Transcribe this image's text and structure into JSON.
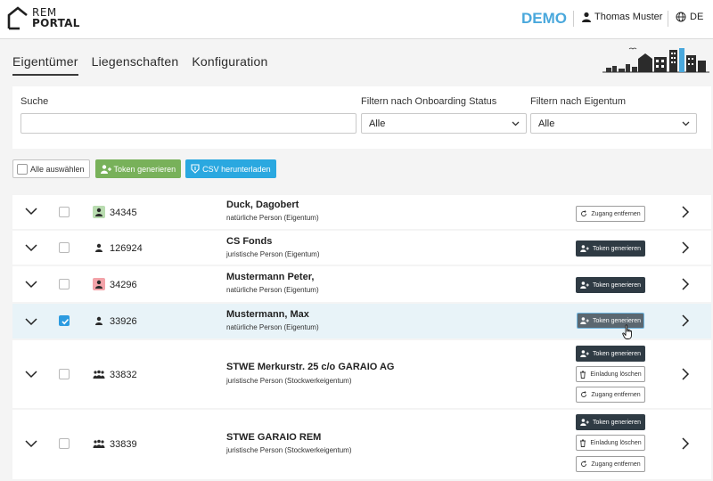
{
  "header": {
    "logo_line1": "REM",
    "logo_line2": "PORTAL",
    "environment": "DEMO",
    "user_name": "Thomas Muster",
    "language": "DE"
  },
  "tabs": [
    {
      "label": "Eigentümer",
      "active": true
    },
    {
      "label": "Liegenschaften",
      "active": false
    },
    {
      "label": "Konfiguration",
      "active": false
    }
  ],
  "filters": {
    "search_label": "Suche",
    "search_value": "",
    "onboarding_label": "Filtern nach Onboarding Status",
    "onboarding_value": "Alle",
    "property_label": "Filtern nach Eigentum",
    "property_value": "Alle"
  },
  "actions": {
    "select_all": "Alle auswählen",
    "generate_tokens": "Token generieren",
    "download_csv": "CSV herunterladen"
  },
  "owners": [
    {
      "id": "34345",
      "name": "Duck, Dagobert",
      "type": "natürliche Person (Eigentum)",
      "icon": "person-icon",
      "icon_bg": "#b9dcb0",
      "checked": false,
      "buttons": [
        "Zugang entfernen"
      ]
    },
    {
      "id": "126924",
      "name": "CS Fonds",
      "type": "juristische Person (Eigentum)",
      "icon": "person-icon",
      "icon_bg": "",
      "checked": false,
      "buttons": [
        "Token generieren"
      ]
    },
    {
      "id": "34296",
      "name": "Mustermann Peter,",
      "type": "natürliche Person (Eigentum)",
      "icon": "person-icon",
      "icon_bg": "#f3a3a9",
      "checked": false,
      "buttons": [
        "Token generieren"
      ]
    },
    {
      "id": "33926",
      "name": "Mustermann, Max",
      "type": "natürliche Person (Eigentum)",
      "icon": "person-icon",
      "icon_bg": "",
      "checked": true,
      "buttons": [
        "Token generieren"
      ]
    },
    {
      "id": "33832",
      "name": "STWE Merkurstr. 25 c/o GARAIO AG",
      "type": "juristische Person (Stockwerkeigentum)",
      "icon": "group-icon",
      "icon_bg": "",
      "checked": false,
      "buttons": [
        "Token generieren",
        "Einladung löschen",
        "Zugang entfernen"
      ]
    },
    {
      "id": "33839",
      "name": "STWE GARAIO REM",
      "type": "juristische Person (Stockwerkeigentum)",
      "icon": "group-icon",
      "icon_bg": "",
      "checked": false,
      "buttons": [
        "Token generieren",
        "Einladung löschen",
        "Zugang entfernen"
      ]
    }
  ],
  "colors": {
    "accent": "#4aa8dc",
    "green": "#78b15a",
    "blue": "#2aa8e0",
    "dark_button": "#2f3b44"
  }
}
